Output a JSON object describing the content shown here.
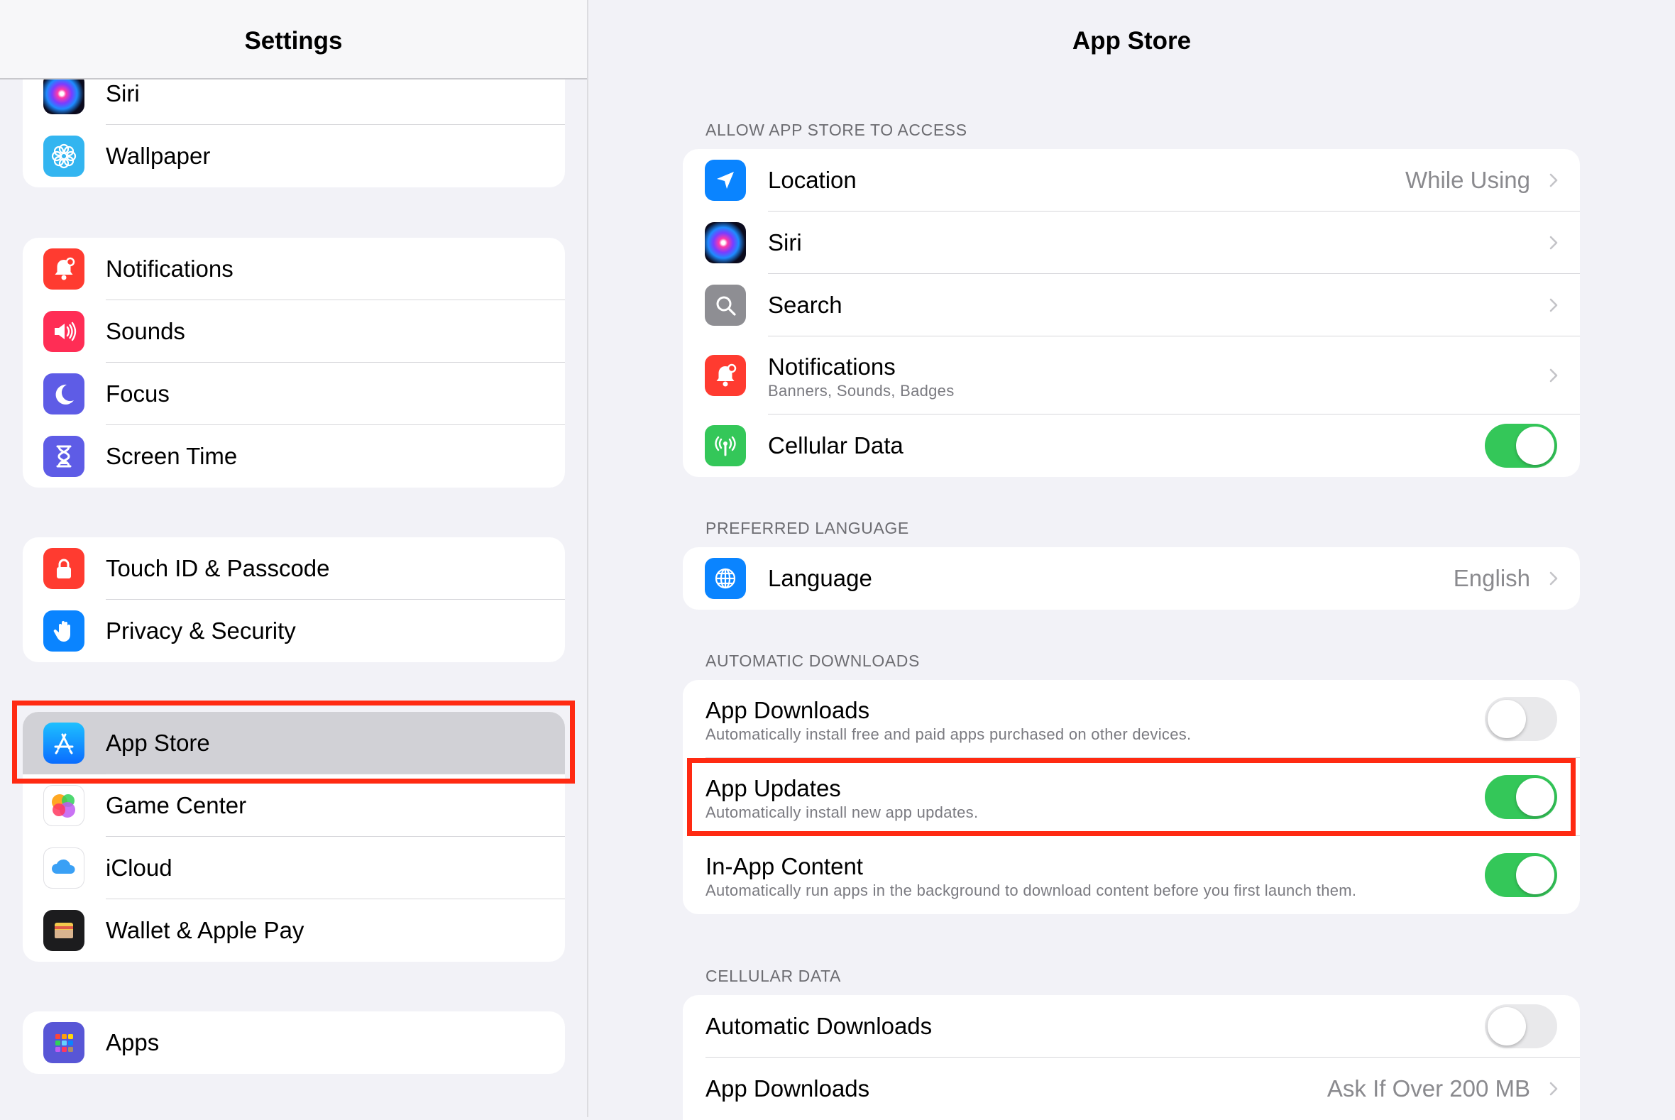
{
  "sidebar": {
    "title": "Settings",
    "groups": [
      {
        "items": [
          {
            "label": "Siri",
            "icon": "siri-icon"
          },
          {
            "label": "Wallpaper",
            "icon": "wallpaper-icon"
          }
        ]
      },
      {
        "items": [
          {
            "label": "Notifications",
            "icon": "notifications-icon"
          },
          {
            "label": "Sounds",
            "icon": "sounds-icon"
          },
          {
            "label": "Focus",
            "icon": "focus-icon"
          },
          {
            "label": "Screen Time",
            "icon": "screen-time-icon"
          }
        ]
      },
      {
        "items": [
          {
            "label": "Touch ID & Passcode",
            "icon": "lock-icon"
          },
          {
            "label": "Privacy & Security",
            "icon": "hand-icon"
          }
        ]
      },
      {
        "items": [
          {
            "label": "App Store",
            "icon": "app-store-icon",
            "selected": true
          },
          {
            "label": "Game Center",
            "icon": "game-center-icon"
          },
          {
            "label": "iCloud",
            "icon": "icloud-icon"
          },
          {
            "label": "Wallet & Apple Pay",
            "icon": "wallet-icon"
          }
        ]
      },
      {
        "items": [
          {
            "label": "Apps",
            "icon": "apps-grid-icon"
          }
        ]
      }
    ]
  },
  "detail": {
    "title": "App Store",
    "sections": [
      {
        "header": "ALLOW APP STORE TO ACCESS",
        "rows": [
          {
            "label": "Location",
            "value": "While Using",
            "icon": "location-arrow-icon"
          },
          {
            "label": "Siri",
            "icon": "siri-icon"
          },
          {
            "label": "Search",
            "icon": "search-icon"
          },
          {
            "label": "Notifications",
            "sub": "Banners, Sounds, Badges",
            "icon": "notifications-icon"
          },
          {
            "label": "Cellular Data",
            "toggle": true,
            "icon": "cellular-antenna-icon"
          }
        ]
      },
      {
        "header": "PREFERRED LANGUAGE",
        "rows": [
          {
            "label": "Language",
            "value": "English",
            "icon": "globe-icon"
          }
        ]
      },
      {
        "header": "AUTOMATIC DOWNLOADS",
        "rows": [
          {
            "label": "App Downloads",
            "sub": "Automatically install free and paid apps purchased on other devices.",
            "toggle": false
          },
          {
            "label": "App Updates",
            "sub": "Automatically install new app updates.",
            "toggle": true
          },
          {
            "label": "In-App Content",
            "sub": "Automatically run apps in the background to download content before you first launch them.",
            "toggle": true
          }
        ]
      },
      {
        "header": "CELLULAR DATA",
        "rows": [
          {
            "label": "Automatic Downloads",
            "toggle": false
          },
          {
            "label": "App Downloads",
            "value": "Ask If Over 200 MB"
          }
        ]
      }
    ]
  },
  "colors": {
    "toggle_on": "#34c759",
    "highlight_box": "#ff2a12",
    "selected_row": "#d1d1d6"
  }
}
